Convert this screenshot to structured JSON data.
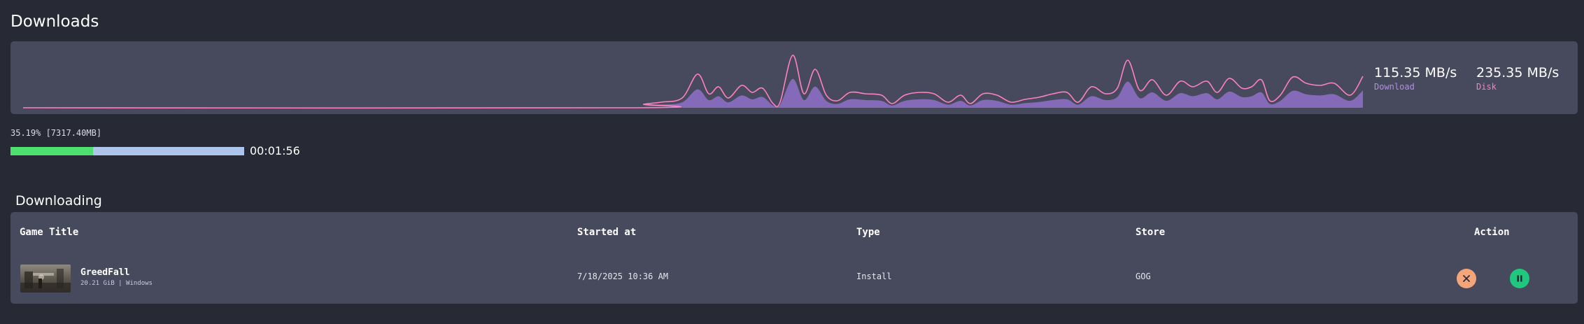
{
  "page": {
    "title": "Downloads"
  },
  "stats": {
    "download": {
      "value": "115.35 MB/s",
      "label": "Download",
      "color": "#b58ce8"
    },
    "disk": {
      "value": "235.35 MB/s",
      "label": "Disk",
      "color": "#ff7fc1"
    },
    "graph_colors": {
      "line": "#ff7fc1",
      "fill": "#8a6bbf"
    }
  },
  "progress": {
    "text": "35.19% [7317.40MB]",
    "fraction": 0.352,
    "eta": "00:01:56",
    "fill_color": "#4de06f",
    "track_color": "#adc5ea"
  },
  "downloading": {
    "section_title": "Downloading",
    "columns": {
      "title": "Game Title",
      "started": "Started at",
      "type": "Type",
      "store": "Store",
      "action": "Action"
    },
    "rows": [
      {
        "title": "GreedFall",
        "meta": "20.21 GiB | Windows",
        "started_at": "7/18/2025 10:36 AM",
        "type": "Install",
        "store": "GOG",
        "actions": {
          "cancel_icon": "close-icon",
          "pause_icon": "pause-icon"
        }
      }
    ]
  }
}
